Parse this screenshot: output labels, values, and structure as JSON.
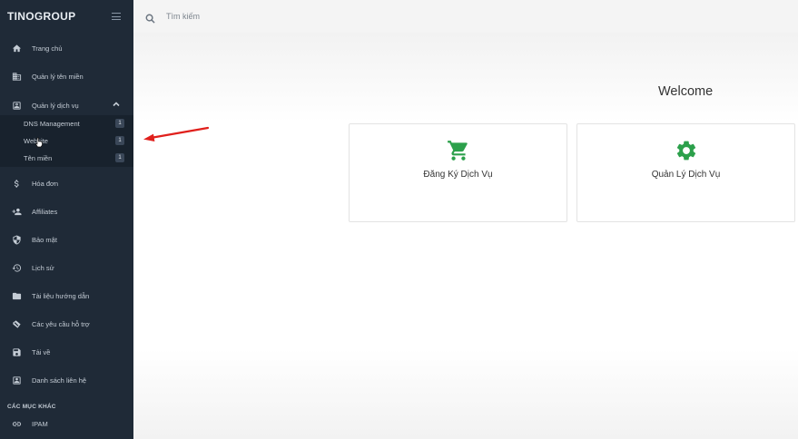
{
  "brand": {
    "logo": "TINOGROUP"
  },
  "search": {
    "placeholder": "Tìm kiếm"
  },
  "sidebar": {
    "items": [
      {
        "label": "Trang chủ",
        "icon": "home-icon"
      },
      {
        "label": "Quản lý tên miền",
        "icon": "domain-icon"
      },
      {
        "label": "Quản lý dịch vụ",
        "icon": "service-icon"
      },
      {
        "label": "Hóa đơn",
        "icon": "dollar-icon"
      },
      {
        "label": "Affiliates",
        "icon": "users-add-icon"
      },
      {
        "label": "Bảo mật",
        "icon": "shield-icon"
      },
      {
        "label": "Lịch sử",
        "icon": "history-icon"
      },
      {
        "label": "Tài liệu hướng dẫn",
        "icon": "folder-icon"
      },
      {
        "label": "Các yêu cầu hỗ trợ",
        "icon": "ticket-icon"
      },
      {
        "label": "Tải về",
        "icon": "save-icon"
      },
      {
        "label": "Danh sách liên hệ",
        "icon": "contact-icon"
      }
    ],
    "sub_items": [
      {
        "label": "DNS Management",
        "badge": "1"
      },
      {
        "label": "Website",
        "badge": "1"
      },
      {
        "label": "Tên miền",
        "badge": "1"
      }
    ],
    "section_label": "CÁC MỤC KHÁC",
    "extra_items": [
      {
        "label": "IPAM",
        "icon": "link-icon"
      }
    ]
  },
  "main": {
    "welcome": "Welcome",
    "cards": [
      {
        "label": "Đăng Ký Dịch Vụ",
        "icon": "cart-icon"
      },
      {
        "label": "Quản Lý Dịch Vụ",
        "icon": "gear-icon"
      }
    ]
  },
  "colors": {
    "sidebar_bg": "#1f2a37",
    "accent_green": "#2ca04b",
    "arrow_red": "#e0201c"
  }
}
